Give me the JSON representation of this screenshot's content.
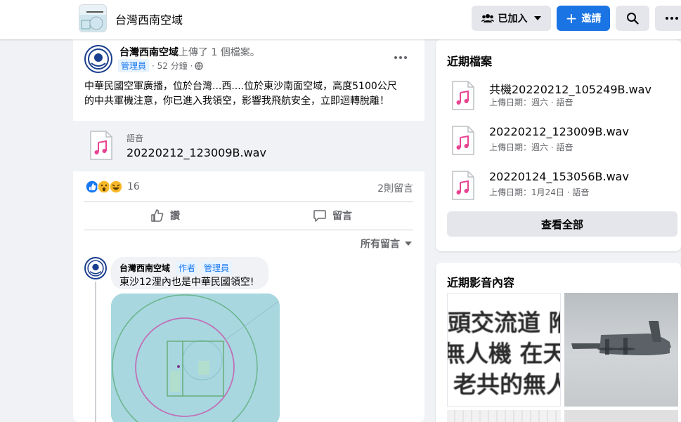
{
  "topbar": {
    "group_name": "台灣西南空域",
    "joined_label": "已加入",
    "invite_label": "邀請"
  },
  "post": {
    "author": "台灣西南空域",
    "action_text": "上傳了 1 個檔案。",
    "role_badge": "管理員",
    "time": "· 52 分鐘 ·",
    "body_line1": "中華民國空軍廣播，位於台灣...西....位於東沙南面空域，高度5100公尺",
    "body_line2": "的中共軍機注意，你已進入我領空，影響我飛航安全，立即迴轉脫離！",
    "attachment_type": "語音",
    "attachment_name": "20220212_123009B.wav",
    "reaction_count": "16",
    "comment_count": "2則留言",
    "like_label": "讚",
    "comment_label": "留言",
    "sort_label": "所有留言"
  },
  "comment": {
    "author": "台灣西南空域",
    "badge_author": "作者",
    "badge_admin": "管理員",
    "text": "東沙12浬內也是中華民國領空!"
  },
  "recent_files": {
    "title": "近期檔案",
    "items": [
      {
        "name": "共機20220212_105249B.wav",
        "meta": "上傳日期：週六 · 語音"
      },
      {
        "name": "20220212_123009B.wav",
        "meta": "上傳日期：週六 · 語音"
      },
      {
        "name": "20220124_153056B.wav",
        "meta": "上傳日期：1月24日 · 語音"
      }
    ],
    "see_all": "查看全部"
  },
  "recent_media": {
    "title": "近期影音內容",
    "thumb1_lines": [
      "頭交流道 附",
      "無人機 在天",
      "老共的無人"
    ]
  },
  "colors": {
    "accent": "#1b74e4",
    "badge_bg": "#e7f3ff",
    "badge_text": "#1877f2",
    "music_pink": "#e84393"
  }
}
